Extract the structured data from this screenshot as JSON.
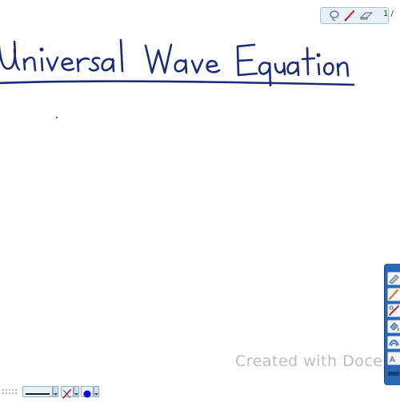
{
  "whiteboard": {
    "handwritten_title": "Universal Wave Equation",
    "ink_color": "#1b2a7a"
  },
  "top_toolbar": {
    "page_indicator": "1 /",
    "icons": [
      "lasso-icon",
      "pen-icon",
      "eraser-icon"
    ]
  },
  "side_palette": {
    "tools": [
      "highlighter-icon",
      "pen-icon",
      "line-icon",
      "fill-icon",
      "shape-icon",
      "text-icon"
    ],
    "accent_color": "#2c67b5"
  },
  "bottom_toolbar": {
    "pen_color": "#0000ff",
    "icons": [
      "grip-dots-icon",
      "line-style-icon",
      "pen-icon",
      "color-swatch-icon"
    ]
  },
  "watermark": {
    "text": "Created with Doce"
  }
}
